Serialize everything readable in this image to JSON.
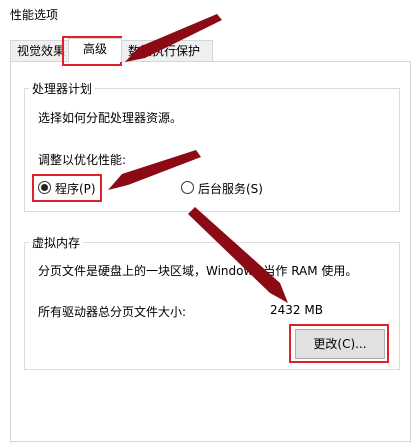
{
  "window": {
    "title": "性能选项"
  },
  "tabs": [
    {
      "label": "视觉效果"
    },
    {
      "label": "高级",
      "active": true
    },
    {
      "label": "数据执行保护"
    }
  ],
  "processor_group": {
    "legend": "处理器计划",
    "description": "选择如何分配处理器资源。",
    "adjust_label": "调整以优化性能:",
    "options": [
      {
        "label": "程序(P)",
        "selected": true
      },
      {
        "label": "后台服务(S)",
        "selected": false
      }
    ]
  },
  "virtual_memory_group": {
    "legend": "虚拟内存",
    "description": "分页文件是硬盘上的一块区域，Windows 当作 RAM 使用。",
    "total_label": "所有驱动器总分页文件大小:",
    "total_value": "2432 MB",
    "change_button": "更改(C)..."
  },
  "annotation_colors": {
    "highlight": "#e0202a",
    "arrow": "#8b0a14"
  }
}
